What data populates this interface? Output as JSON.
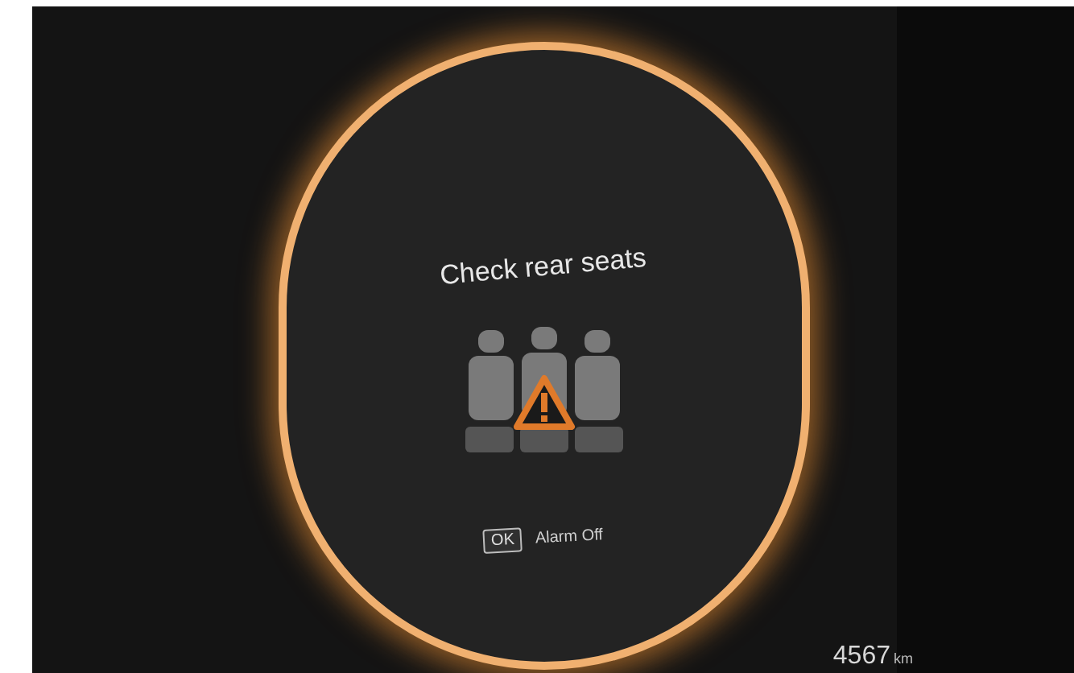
{
  "message": {
    "title": "Check rear seats",
    "button": "OK",
    "action": "Alarm Off"
  },
  "odometer": {
    "value": "4567",
    "unit": "km"
  }
}
